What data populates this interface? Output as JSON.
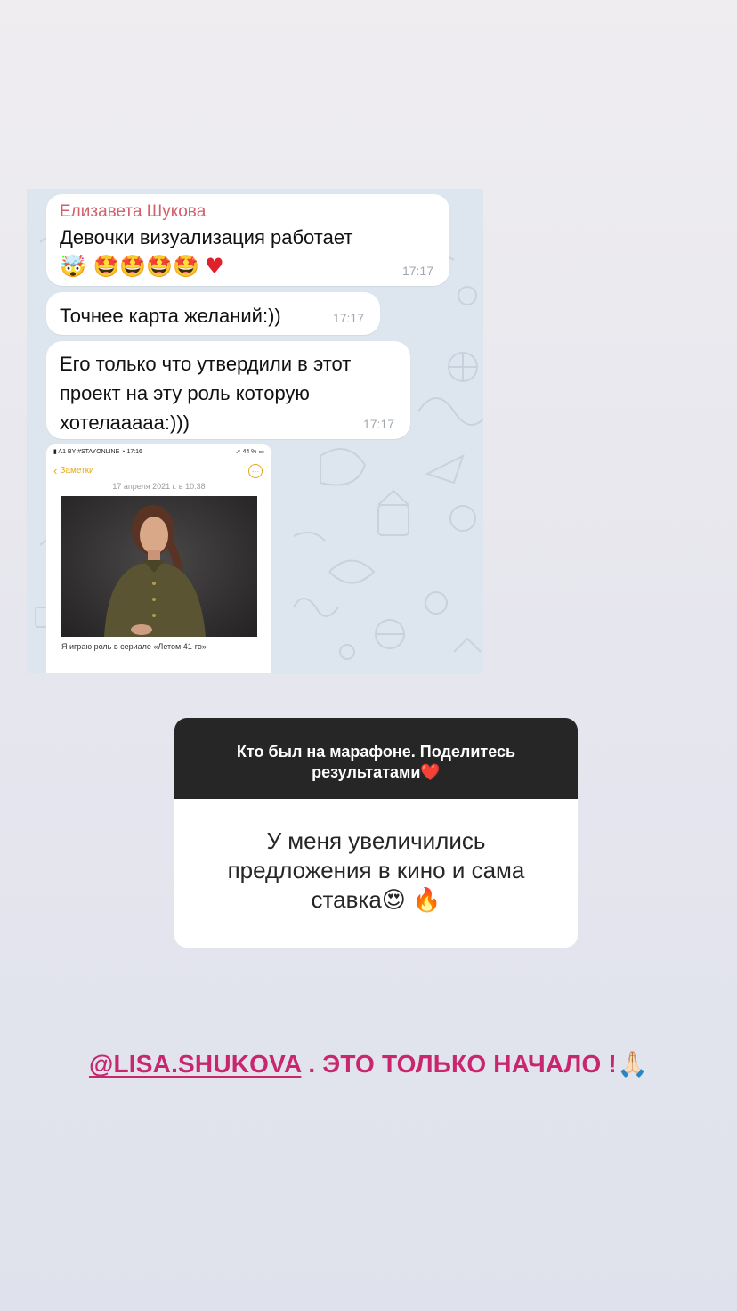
{
  "chat": {
    "messages": [
      {
        "sender": "Елизавета Шукова",
        "text": "Девочки визуализация работает",
        "emoji_line": "🤯 🤩🤩🤩🤩",
        "heart": "♥",
        "time": "17:17"
      },
      {
        "text": "Точнее карта желаний:))",
        "time": "17:17"
      },
      {
        "text_lines": [
          "Его только что утвердили в этот",
          "проект на эту роль которую",
          "хотелааааа:)))"
        ],
        "time": "17:17"
      }
    ],
    "screenshot": {
      "status_left": "A1 BY #STAYONLINE",
      "status_time": "17:16",
      "status_right": "44 %",
      "back_label": "Заметки",
      "more_icon": "…",
      "date": "17 апреля 2021 г. в 10:38",
      "caption": "Я играю роль в сериале «Летом 41-го»"
    }
  },
  "question": {
    "prompt": "Кто был на марафоне. Поделитесь результатами❤️",
    "answer": "У меня увеличились предложения в кино и сама ставка😍 🔥"
  },
  "footer": {
    "mention": "@LISA.SHUKOVA",
    "text": " . ЭТО ТОЛЬКО НАЧАЛО !🙏🏻"
  },
  "colors": {
    "sender_name": "#d2606a",
    "accent_yellow": "#e3a91a",
    "question_header_bg": "#262626",
    "footer_text": "#c8266f"
  }
}
